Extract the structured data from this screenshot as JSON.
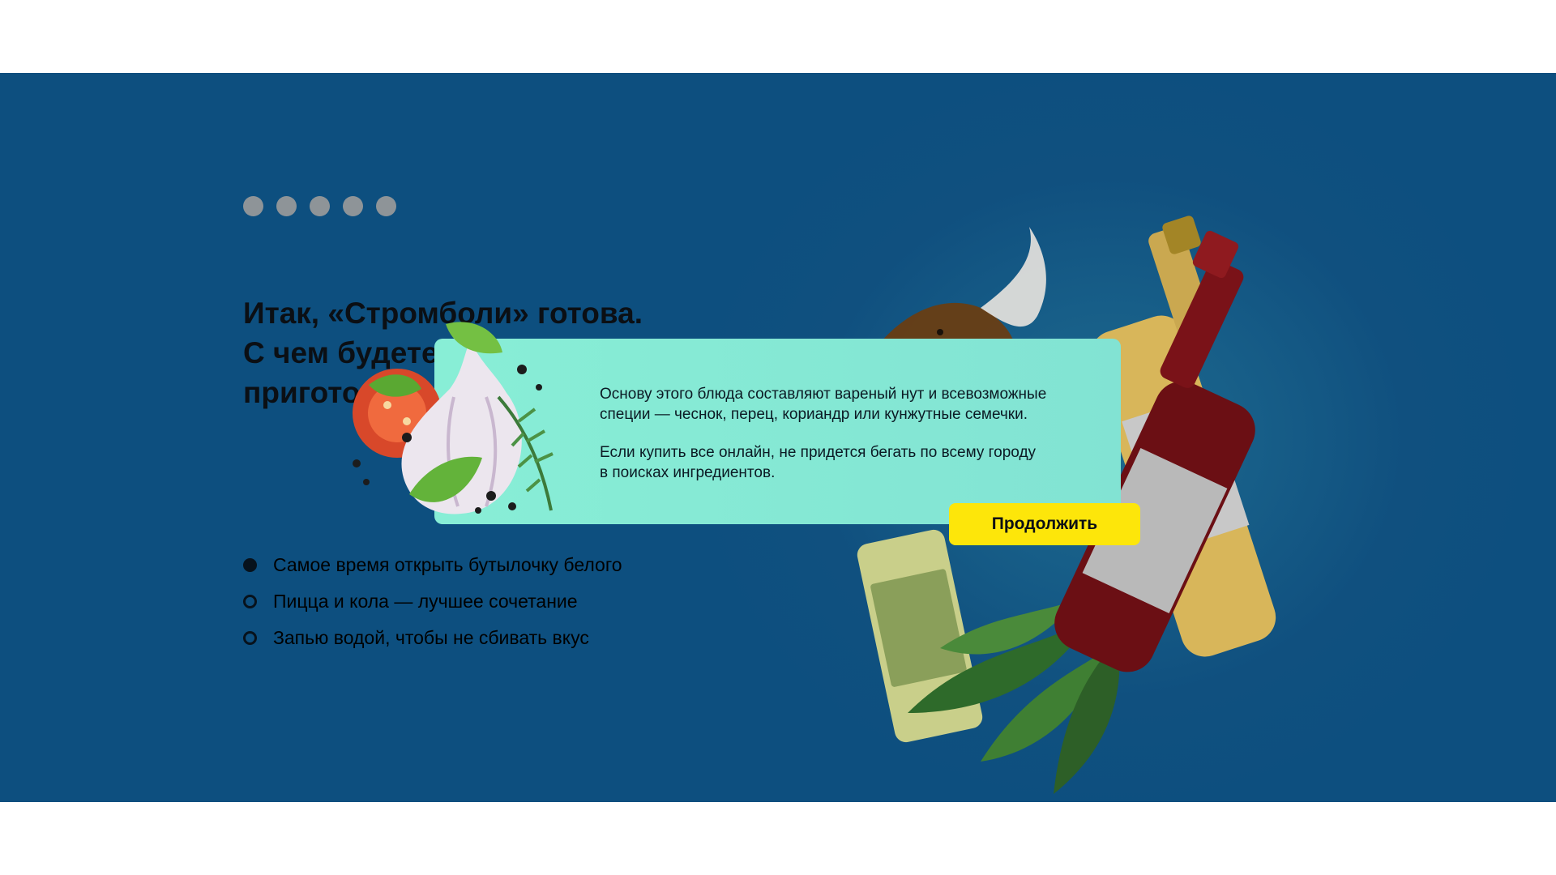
{
  "progress": {
    "total_steps": 5,
    "current_step": 5
  },
  "question": {
    "lines": [
      "Итак, «Стромболи» готова.",
      "С чем будете",
      "пригото"
    ]
  },
  "options": [
    {
      "label": "Самое время открыть бутылочку белого",
      "selected": true
    },
    {
      "label": "Пицца и кола — лучшее сочетание",
      "selected": false
    },
    {
      "label": "Запью водой, чтобы не сбивать вкус",
      "selected": false
    }
  ],
  "modal": {
    "paragraph1_line1": "Основу этого блюда составляют вареный нут и всевозможные",
    "paragraph1_line2": "специи — чеснок, перец, кориандр или кунжутные семечки.",
    "paragraph2_line1": "Если купить все онлайн, не придется бегать по всему городу",
    "paragraph2_line2": "в поисках ингредиентов.",
    "continue_label": "Продолжить"
  },
  "colors": {
    "background": "#0d4f7f",
    "modal": "#86e8d5",
    "button": "#fde60a",
    "text": "#0b0f14"
  }
}
